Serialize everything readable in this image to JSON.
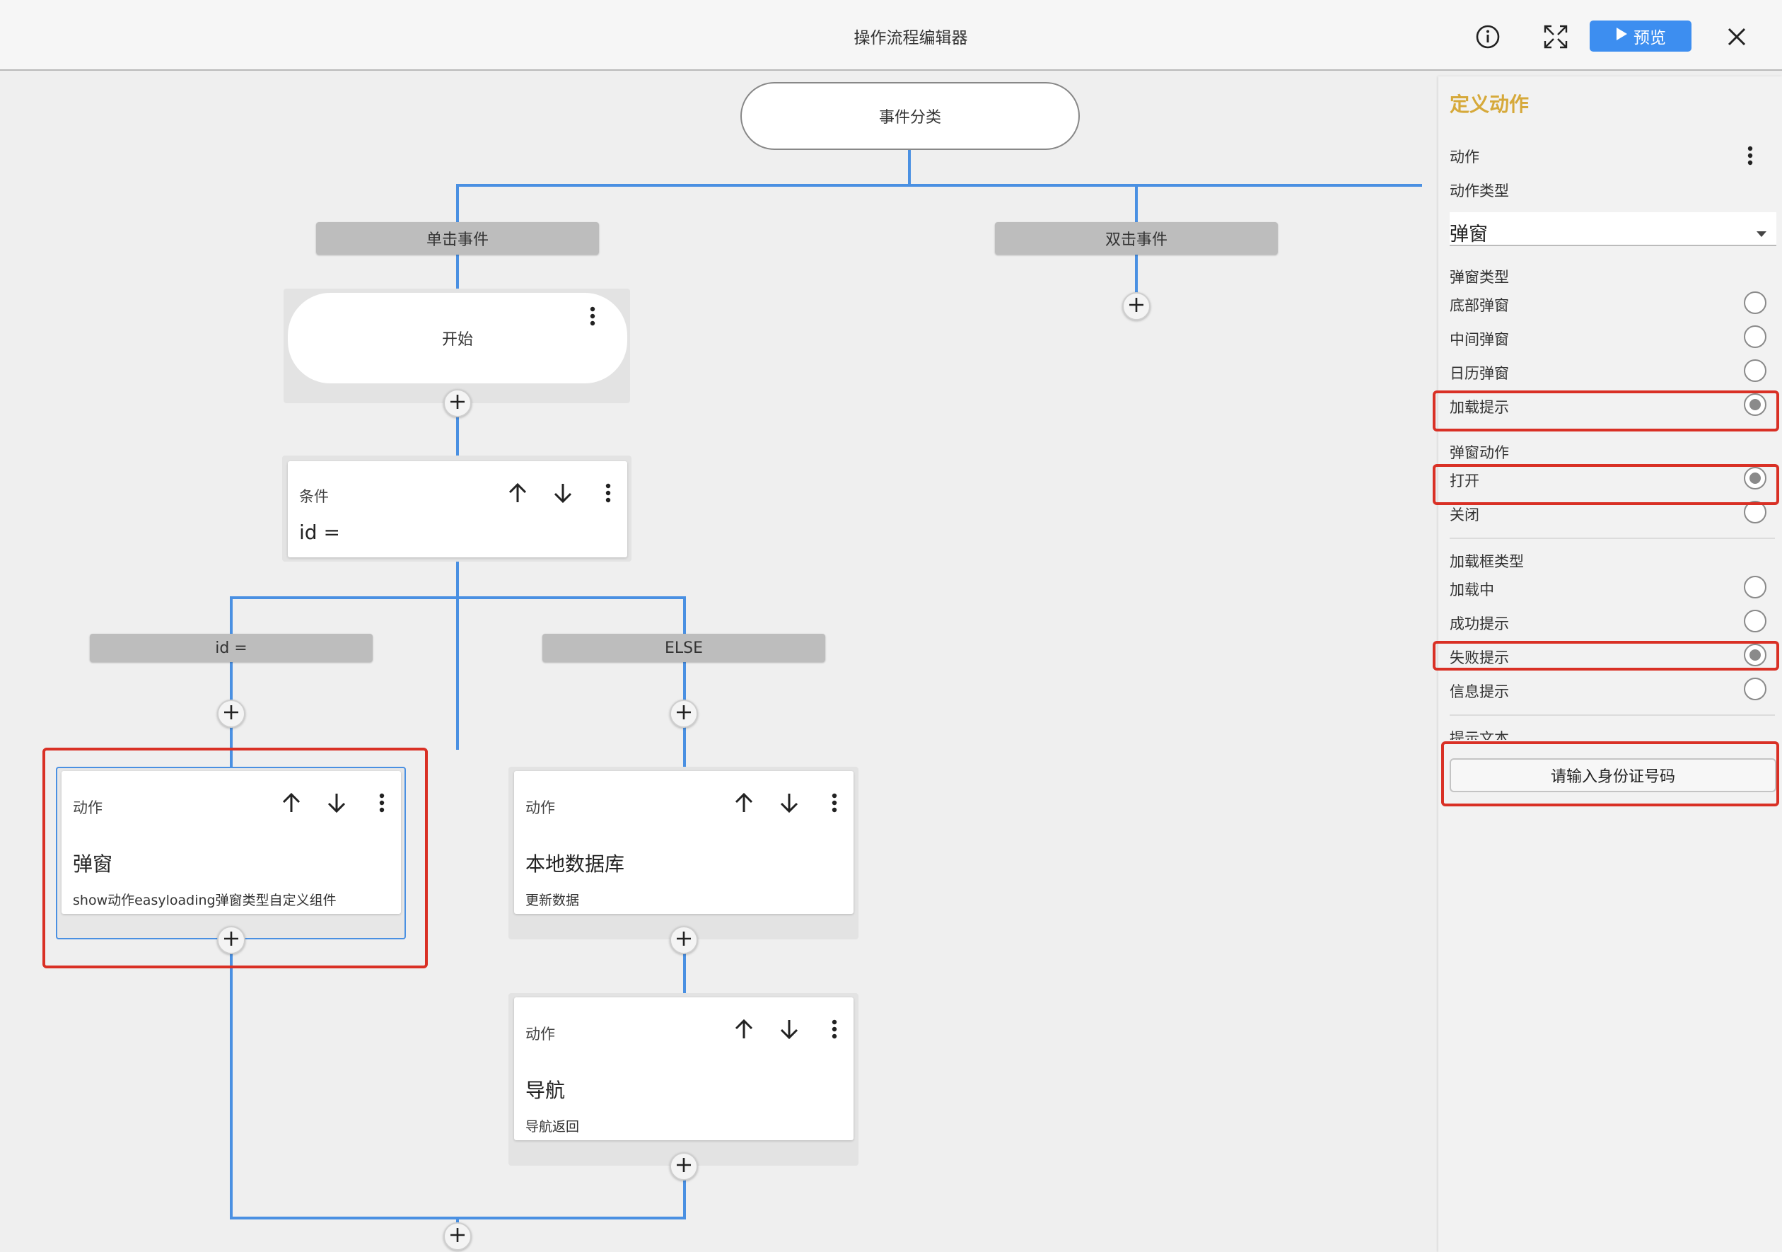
{
  "header": {
    "title": "操作流程编辑器",
    "preview_label": "预览",
    "icons": [
      "info-icon",
      "fullscreen-icon",
      "play-icon",
      "close-icon"
    ]
  },
  "flow": {
    "root_label": "事件分类",
    "branches": [
      "单击事件",
      "双击事件"
    ],
    "start_label": "开始",
    "condition": {
      "kind": "条件",
      "expr": "id ="
    },
    "sub_branches": [
      "id =",
      "ELSE"
    ],
    "actions": [
      {
        "kind": "动作",
        "name": "弹窗",
        "desc": "show动作easyloading弹窗类型自定义组件"
      },
      {
        "kind": "动作",
        "name": "本地数据库",
        "desc": "更新数据"
      },
      {
        "kind": "动作",
        "name": "导航",
        "desc": "导航返回"
      }
    ]
  },
  "panel": {
    "title": "定义动作",
    "action_label": "动作",
    "action_type_label": "动作类型",
    "action_type_value": "弹窗",
    "popup_type_label": "弹窗类型",
    "popup_types": [
      {
        "label": "底部弹窗",
        "selected": false
      },
      {
        "label": "中间弹窗",
        "selected": false
      },
      {
        "label": "日历弹窗",
        "selected": false
      },
      {
        "label": "加载提示",
        "selected": true
      }
    ],
    "popup_action_label": "弹窗动作",
    "popup_actions": [
      {
        "label": "打开",
        "selected": true
      },
      {
        "label": "关闭",
        "selected": false
      }
    ],
    "loading_type_label": "加载框类型",
    "loading_types": [
      {
        "label": "加载中",
        "selected": false
      },
      {
        "label": "成功提示",
        "selected": false
      },
      {
        "label": "失败提示",
        "selected": true
      },
      {
        "label": "信息提示",
        "selected": false
      }
    ],
    "hint_text_label": "提示文本",
    "hint_text_value": "请输入身份证号码"
  },
  "colors": {
    "accent": "#3d8ef0",
    "flow_line": "#4a90e2",
    "panel_title": "#d6a93a",
    "highlight": "#d93025"
  }
}
